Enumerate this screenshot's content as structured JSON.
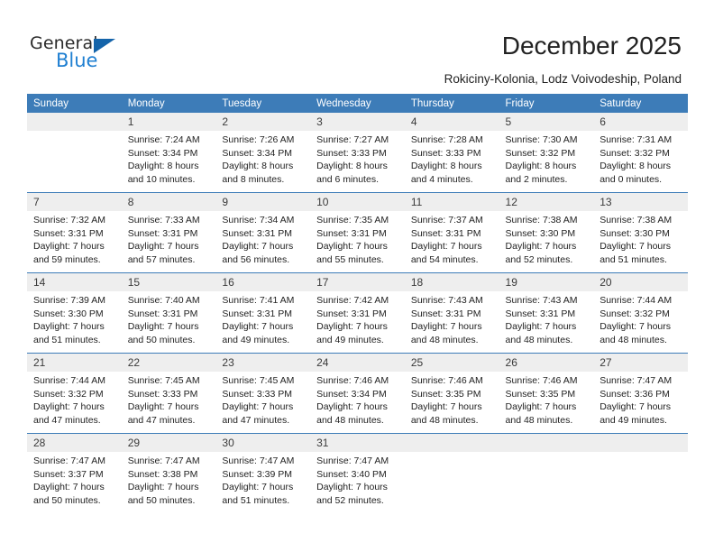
{
  "brand": {
    "name_part1": "General",
    "name_part2": "Blue",
    "triangle_color": "#1464aa",
    "blue_color": "#1f7fd1"
  },
  "header": {
    "title": "December 2025",
    "subtitle": "Rokiciny-Kolonia, Lodz Voivodeship, Poland"
  },
  "calendar": {
    "header_bg": "#3d7cb8",
    "daynum_bg": "#eeeeee",
    "weekdays": [
      "Sunday",
      "Monday",
      "Tuesday",
      "Wednesday",
      "Thursday",
      "Friday",
      "Saturday"
    ],
    "weeks": [
      [
        {
          "day": "",
          "sunrise": "",
          "sunset": "",
          "daylight_line1": "",
          "daylight_line2": ""
        },
        {
          "day": "1",
          "sunrise": "Sunrise: 7:24 AM",
          "sunset": "Sunset: 3:34 PM",
          "daylight_line1": "Daylight: 8 hours",
          "daylight_line2": "and 10 minutes."
        },
        {
          "day": "2",
          "sunrise": "Sunrise: 7:26 AM",
          "sunset": "Sunset: 3:34 PM",
          "daylight_line1": "Daylight: 8 hours",
          "daylight_line2": "and 8 minutes."
        },
        {
          "day": "3",
          "sunrise": "Sunrise: 7:27 AM",
          "sunset": "Sunset: 3:33 PM",
          "daylight_line1": "Daylight: 8 hours",
          "daylight_line2": "and 6 minutes."
        },
        {
          "day": "4",
          "sunrise": "Sunrise: 7:28 AM",
          "sunset": "Sunset: 3:33 PM",
          "daylight_line1": "Daylight: 8 hours",
          "daylight_line2": "and 4 minutes."
        },
        {
          "day": "5",
          "sunrise": "Sunrise: 7:30 AM",
          "sunset": "Sunset: 3:32 PM",
          "daylight_line1": "Daylight: 8 hours",
          "daylight_line2": "and 2 minutes."
        },
        {
          "day": "6",
          "sunrise": "Sunrise: 7:31 AM",
          "sunset": "Sunset: 3:32 PM",
          "daylight_line1": "Daylight: 8 hours",
          "daylight_line2": "and 0 minutes."
        }
      ],
      [
        {
          "day": "7",
          "sunrise": "Sunrise: 7:32 AM",
          "sunset": "Sunset: 3:31 PM",
          "daylight_line1": "Daylight: 7 hours",
          "daylight_line2": "and 59 minutes."
        },
        {
          "day": "8",
          "sunrise": "Sunrise: 7:33 AM",
          "sunset": "Sunset: 3:31 PM",
          "daylight_line1": "Daylight: 7 hours",
          "daylight_line2": "and 57 minutes."
        },
        {
          "day": "9",
          "sunrise": "Sunrise: 7:34 AM",
          "sunset": "Sunset: 3:31 PM",
          "daylight_line1": "Daylight: 7 hours",
          "daylight_line2": "and 56 minutes."
        },
        {
          "day": "10",
          "sunrise": "Sunrise: 7:35 AM",
          "sunset": "Sunset: 3:31 PM",
          "daylight_line1": "Daylight: 7 hours",
          "daylight_line2": "and 55 minutes."
        },
        {
          "day": "11",
          "sunrise": "Sunrise: 7:37 AM",
          "sunset": "Sunset: 3:31 PM",
          "daylight_line1": "Daylight: 7 hours",
          "daylight_line2": "and 54 minutes."
        },
        {
          "day": "12",
          "sunrise": "Sunrise: 7:38 AM",
          "sunset": "Sunset: 3:30 PM",
          "daylight_line1": "Daylight: 7 hours",
          "daylight_line2": "and 52 minutes."
        },
        {
          "day": "13",
          "sunrise": "Sunrise: 7:38 AM",
          "sunset": "Sunset: 3:30 PM",
          "daylight_line1": "Daylight: 7 hours",
          "daylight_line2": "and 51 minutes."
        }
      ],
      [
        {
          "day": "14",
          "sunrise": "Sunrise: 7:39 AM",
          "sunset": "Sunset: 3:30 PM",
          "daylight_line1": "Daylight: 7 hours",
          "daylight_line2": "and 51 minutes."
        },
        {
          "day": "15",
          "sunrise": "Sunrise: 7:40 AM",
          "sunset": "Sunset: 3:31 PM",
          "daylight_line1": "Daylight: 7 hours",
          "daylight_line2": "and 50 minutes."
        },
        {
          "day": "16",
          "sunrise": "Sunrise: 7:41 AM",
          "sunset": "Sunset: 3:31 PM",
          "daylight_line1": "Daylight: 7 hours",
          "daylight_line2": "and 49 minutes."
        },
        {
          "day": "17",
          "sunrise": "Sunrise: 7:42 AM",
          "sunset": "Sunset: 3:31 PM",
          "daylight_line1": "Daylight: 7 hours",
          "daylight_line2": "and 49 minutes."
        },
        {
          "day": "18",
          "sunrise": "Sunrise: 7:43 AM",
          "sunset": "Sunset: 3:31 PM",
          "daylight_line1": "Daylight: 7 hours",
          "daylight_line2": "and 48 minutes."
        },
        {
          "day": "19",
          "sunrise": "Sunrise: 7:43 AM",
          "sunset": "Sunset: 3:31 PM",
          "daylight_line1": "Daylight: 7 hours",
          "daylight_line2": "and 48 minutes."
        },
        {
          "day": "20",
          "sunrise": "Sunrise: 7:44 AM",
          "sunset": "Sunset: 3:32 PM",
          "daylight_line1": "Daylight: 7 hours",
          "daylight_line2": "and 48 minutes."
        }
      ],
      [
        {
          "day": "21",
          "sunrise": "Sunrise: 7:44 AM",
          "sunset": "Sunset: 3:32 PM",
          "daylight_line1": "Daylight: 7 hours",
          "daylight_line2": "and 47 minutes."
        },
        {
          "day": "22",
          "sunrise": "Sunrise: 7:45 AM",
          "sunset": "Sunset: 3:33 PM",
          "daylight_line1": "Daylight: 7 hours",
          "daylight_line2": "and 47 minutes."
        },
        {
          "day": "23",
          "sunrise": "Sunrise: 7:45 AM",
          "sunset": "Sunset: 3:33 PM",
          "daylight_line1": "Daylight: 7 hours",
          "daylight_line2": "and 47 minutes."
        },
        {
          "day": "24",
          "sunrise": "Sunrise: 7:46 AM",
          "sunset": "Sunset: 3:34 PM",
          "daylight_line1": "Daylight: 7 hours",
          "daylight_line2": "and 48 minutes."
        },
        {
          "day": "25",
          "sunrise": "Sunrise: 7:46 AM",
          "sunset": "Sunset: 3:35 PM",
          "daylight_line1": "Daylight: 7 hours",
          "daylight_line2": "and 48 minutes."
        },
        {
          "day": "26",
          "sunrise": "Sunrise: 7:46 AM",
          "sunset": "Sunset: 3:35 PM",
          "daylight_line1": "Daylight: 7 hours",
          "daylight_line2": "and 48 minutes."
        },
        {
          "day": "27",
          "sunrise": "Sunrise: 7:47 AM",
          "sunset": "Sunset: 3:36 PM",
          "daylight_line1": "Daylight: 7 hours",
          "daylight_line2": "and 49 minutes."
        }
      ],
      [
        {
          "day": "28",
          "sunrise": "Sunrise: 7:47 AM",
          "sunset": "Sunset: 3:37 PM",
          "daylight_line1": "Daylight: 7 hours",
          "daylight_line2": "and 50 minutes."
        },
        {
          "day": "29",
          "sunrise": "Sunrise: 7:47 AM",
          "sunset": "Sunset: 3:38 PM",
          "daylight_line1": "Daylight: 7 hours",
          "daylight_line2": "and 50 minutes."
        },
        {
          "day": "30",
          "sunrise": "Sunrise: 7:47 AM",
          "sunset": "Sunset: 3:39 PM",
          "daylight_line1": "Daylight: 7 hours",
          "daylight_line2": "and 51 minutes."
        },
        {
          "day": "31",
          "sunrise": "Sunrise: 7:47 AM",
          "sunset": "Sunset: 3:40 PM",
          "daylight_line1": "Daylight: 7 hours",
          "daylight_line2": "and 52 minutes."
        },
        {
          "day": "",
          "sunrise": "",
          "sunset": "",
          "daylight_line1": "",
          "daylight_line2": ""
        },
        {
          "day": "",
          "sunrise": "",
          "sunset": "",
          "daylight_line1": "",
          "daylight_line2": ""
        },
        {
          "day": "",
          "sunrise": "",
          "sunset": "",
          "daylight_line1": "",
          "daylight_line2": ""
        }
      ]
    ]
  }
}
